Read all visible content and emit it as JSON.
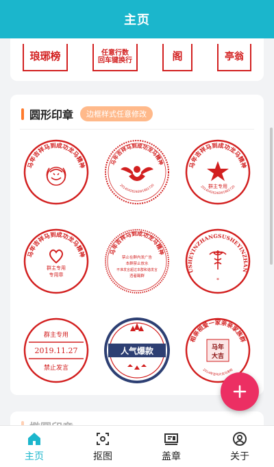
{
  "app": {
    "title": "主页"
  },
  "top_card": {
    "stamps": [
      {
        "text": "琅琊榜"
      },
      {
        "line1": "任意行数",
        "line2": "回车键换行"
      },
      {
        "text": "阁"
      },
      {
        "text": "亭翁"
      }
    ]
  },
  "round_section": {
    "title": "圆形印章",
    "tag": "边框样式任意修改",
    "stamps": [
      {
        "name": "lion-stamp",
        "arc": "马年吉祥马到成功龙马精神"
      },
      {
        "name": "cupid-stamp",
        "arc": "马年吉祥马到成功龙马精神",
        "bottom": "2014042624EW1981720"
      },
      {
        "name": "star-stamp",
        "arc": "马年吉祥马到成功龙马精神",
        "center": "群主专用",
        "bottom": "2014042624EW1981720"
      },
      {
        "name": "heart-stamp",
        "arc": "马年吉祥马到成功龙马精神",
        "center1": "群主专用",
        "center2": "专用章"
      },
      {
        "name": "rules-stamp",
        "arc": "马年吉祥马到成功龙马精神",
        "lines": [
          "禁止在群内发广告",
          "本群禁止放水",
          "不准发言超过本群和谐发言",
          "违者踢群"
        ]
      },
      {
        "name": "medical-stamp",
        "arc": "SUSHEYINZHANGSUSHEYINZHANG"
      },
      {
        "name": "date-stamp",
        "top": "群主专用",
        "date": "2019.11.27",
        "bottom": "禁止发言"
      },
      {
        "name": "popular-stamp",
        "text": "人气爆款"
      },
      {
        "name": "family-stamp",
        "arc": "相亲相爱一家亲亲家族群",
        "center": "马年大吉",
        "bottom": "2014年吉马大吉马来啦"
      }
    ]
  },
  "oval_section": {
    "title": "椭圆印章"
  },
  "fab": {
    "label": "+"
  },
  "nav": [
    {
      "label": "主页",
      "icon": "home-icon"
    },
    {
      "label": "抠图",
      "icon": "crop-icon"
    },
    {
      "label": "盖章",
      "icon": "stamp-board-icon"
    },
    {
      "label": "关于",
      "icon": "user-circle-icon"
    }
  ],
  "colors": {
    "primary": "#1bb6cc",
    "stamp_red": "#d21f1f",
    "fab": "#ec2f63",
    "accent": "#ff7a2c",
    "tag_bg": "#ffb98a",
    "navy": "#2d3f73"
  }
}
